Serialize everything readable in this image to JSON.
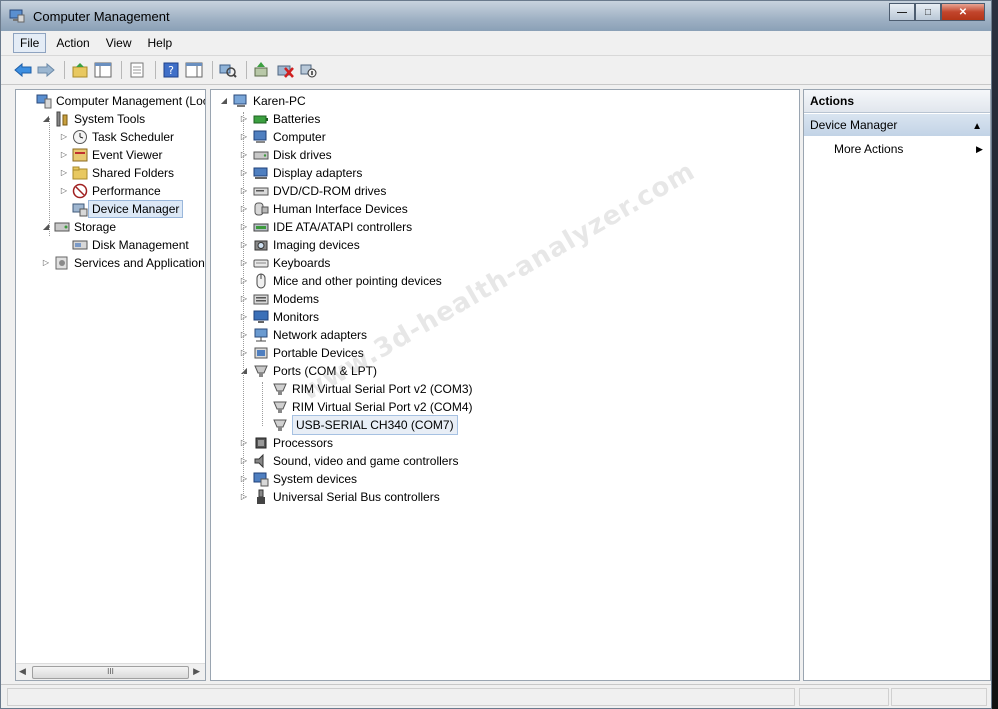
{
  "window": {
    "title": "Computer Management"
  },
  "menu": [
    "File",
    "Action",
    "View",
    "Help"
  ],
  "left_tree": [
    {
      "label": "Computer Management (Local",
      "level": 0,
      "expander": "",
      "icon": "computer-management-icon"
    },
    {
      "label": "System Tools",
      "level": 1,
      "expander": "open",
      "icon": "tools-icon"
    },
    {
      "label": "Task Scheduler",
      "level": 2,
      "expander": "closed",
      "icon": "clock-icon"
    },
    {
      "label": "Event Viewer",
      "level": 2,
      "expander": "closed",
      "icon": "event-viewer-icon"
    },
    {
      "label": "Shared Folders",
      "level": 2,
      "expander": "closed",
      "icon": "folder-icon"
    },
    {
      "label": "Performance",
      "level": 2,
      "expander": "closed",
      "icon": "performance-icon"
    },
    {
      "label": "Device Manager",
      "level": 2,
      "expander": "",
      "icon": "device-manager-icon",
      "selected": true
    },
    {
      "label": "Storage",
      "level": 1,
      "expander": "open",
      "icon": "storage-icon"
    },
    {
      "label": "Disk Management",
      "level": 2,
      "expander": "",
      "icon": "disk-icon"
    },
    {
      "label": "Services and Applications",
      "level": 1,
      "expander": "closed",
      "icon": "services-icon"
    }
  ],
  "device_tree": {
    "root": "Karen-PC",
    "items": [
      {
        "label": "Batteries",
        "icon": "battery-icon"
      },
      {
        "label": "Computer",
        "icon": "computer-icon"
      },
      {
        "label": "Disk drives",
        "icon": "disk-drive-icon"
      },
      {
        "label": "Display adapters",
        "icon": "display-adapter-icon"
      },
      {
        "label": "DVD/CD-ROM drives",
        "icon": "dvd-icon"
      },
      {
        "label": "Human Interface Devices",
        "icon": "hid-icon"
      },
      {
        "label": "IDE ATA/ATAPI controllers",
        "icon": "ide-icon"
      },
      {
        "label": "Imaging devices",
        "icon": "imaging-icon"
      },
      {
        "label": "Keyboards",
        "icon": "keyboard-icon"
      },
      {
        "label": "Mice and other pointing devices",
        "icon": "mouse-icon"
      },
      {
        "label": "Modems",
        "icon": "modem-icon"
      },
      {
        "label": "Monitors",
        "icon": "monitor-icon"
      },
      {
        "label": "Network adapters",
        "icon": "network-icon"
      },
      {
        "label": "Portable Devices",
        "icon": "portable-icon"
      },
      {
        "label": "Ports (COM & LPT)",
        "icon": "port-icon",
        "expanded": true,
        "children": [
          {
            "label": "RIM Virtual Serial Port v2 (COM3)"
          },
          {
            "label": "RIM Virtual Serial Port v2 (COM4)"
          },
          {
            "label": "USB-SERIAL CH340 (COM7)",
            "selected": true
          }
        ]
      },
      {
        "label": "Processors",
        "icon": "processor-icon"
      },
      {
        "label": "Sound, video and game controllers",
        "icon": "sound-icon"
      },
      {
        "label": "System devices",
        "icon": "system-icon"
      },
      {
        "label": "Universal Serial Bus controllers",
        "icon": "usb-icon"
      }
    ]
  },
  "actions": {
    "header": "Actions",
    "section": "Device Manager",
    "item": "More Actions"
  },
  "watermark": "www.3d-health-analyzer.com",
  "scroll_thumb": "III"
}
